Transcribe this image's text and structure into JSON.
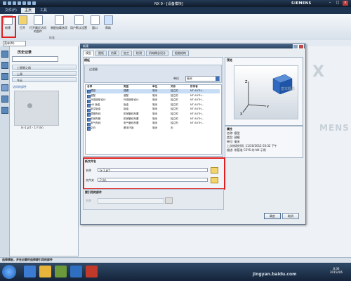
{
  "window": {
    "title": "NX 9 - [设备模块]",
    "brand": "SIEMENS"
  },
  "tabs": [
    "文件(F)",
    "主页",
    "工具"
  ],
  "ribbon": {
    "buttons": [
      "新建",
      "打开",
      "打开最近访问的部件",
      "装配加载选项",
      "用户默认设置",
      "窗口",
      "帮助"
    ],
    "group_label": "标准"
  },
  "toolbar": {
    "filter_label": "菜单(M)"
  },
  "history": {
    "title": "历史记录",
    "groups": [
      "上星期之前",
      "上周",
      "今天"
    ],
    "recent_label": "访问的部件",
    "recent_file": "lx-1.prt - 1 F:\\lx\\"
  },
  "watermark": {
    "large": "X",
    "small": "MENS"
  },
  "dialog": {
    "title": "新建",
    "tabs": [
      "模型",
      "图纸",
      "仿真",
      "加工",
      "检测",
      "机电概念设计",
      "船舶结构"
    ],
    "templates_heading": "模板",
    "filter_title": "过滤器",
    "unit_label": "单位",
    "unit_value": "毫米",
    "table_headers": [
      "名称",
      "类型",
      "单位",
      "关系",
      "所有者"
    ],
    "rows": [
      [
        "模型",
        "建模",
        "毫米",
        "独立的",
        "NT AUTH..."
      ],
      [
        "装配",
        "装配",
        "毫米",
        "独立的",
        "NT AUTH..."
      ],
      [
        "外观造型设计",
        "外观造型设计",
        "毫米",
        "独立的",
        "NT AUTH..."
      ],
      [
        "NX 钣金",
        "钣金",
        "毫米",
        "独立的",
        "NT AUTH..."
      ],
      [
        "航空钣金",
        "钣金",
        "毫米",
        "独立的",
        "NT AUTH..."
      ],
      [
        "逻辑布线",
        "机械管线布置",
        "毫米",
        "独立的",
        "NT AUTH..."
      ],
      [
        "机械布管",
        "机械管线布置",
        "毫米",
        "独立的",
        "NT AUTH..."
      ],
      [
        "电气布线",
        "电气管线布置",
        "毫米",
        "独立的",
        "NT AUTH..."
      ],
      [
        "空白",
        "基本环境",
        "毫米",
        "无",
        ""
      ]
    ],
    "preview_heading": "预览",
    "preview_caption": "基本概念",
    "properties_heading": "属性",
    "properties": [
      "名称: 模型",
      "类型: 建模",
      "单位: 毫米",
      "上次修改时间: 11/30/2012 03:32 下午",
      "描述: 带基准 CSYS 的 NX 示例"
    ],
    "newfile_heading": "新文件名",
    "name_label": "名称",
    "name_value": "lx-1.prt",
    "folder_label": "文件夹",
    "folder_value": "F:\\lx\\",
    "ref_heading": "要引用的部件",
    "ref_label": "名称",
    "ok_label": "确定",
    "cancel_label": "取消"
  },
  "status": {
    "text": "选择模板，并在必要时选择要引用的部件"
  },
  "taskbar": {
    "time": "8:36",
    "date": "2015/4/6",
    "watermark": "jingyan.baidu.com"
  }
}
